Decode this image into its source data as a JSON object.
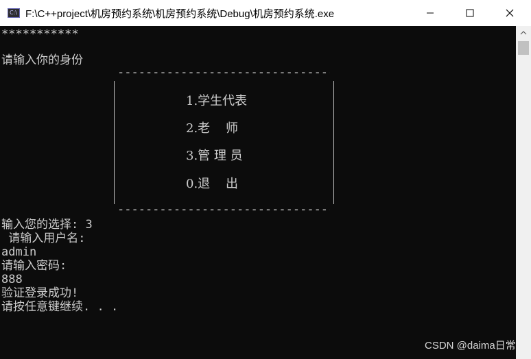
{
  "window": {
    "icon_label": "C:\\",
    "title": "F:\\C++project\\机房预约系统\\机房预约系统\\Debug\\机房预约系统.exe",
    "minimize_glyph": "—",
    "close_glyph": "✕"
  },
  "console": {
    "stars": "***********",
    "identity_prompt": "请输入你的身份",
    "menu_border": "--------------------------------",
    "menu": {
      "item1": "1.学生代表",
      "item2": "2.老    师",
      "item3": "3.管 理 员",
      "item0": "0.退    出"
    },
    "choice_line": "输入您的选择: 3",
    "username_prompt": " 请输入用户名:",
    "username_value": "admin",
    "password_prompt": "请输入密码:",
    "password_value": "888",
    "success_msg": "验证登录成功!",
    "continue_msg": "请按任意键继续. . ."
  },
  "watermark": "CSDN @daima日常",
  "colors": {
    "console_bg": "#0c0c0c",
    "console_text": "#cccccc",
    "titlebar_bg": "#ffffff"
  }
}
